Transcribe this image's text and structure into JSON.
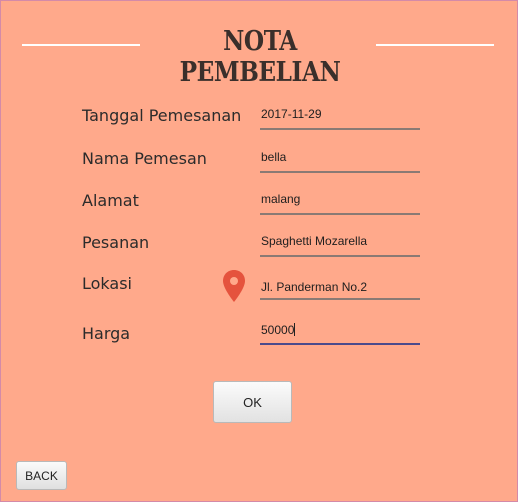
{
  "header": {
    "title": "NOTA PEMBELIAN"
  },
  "form": {
    "tanggal": {
      "label": "Tanggal Pemesanan",
      "value": "2017-11-29"
    },
    "nama": {
      "label": "Nama Pemesan",
      "value": "bella"
    },
    "alamat": {
      "label": "Alamat",
      "value": "malang"
    },
    "pesanan": {
      "label": "Pesanan",
      "value": "Spaghetti Mozarella"
    },
    "lokasi": {
      "label": "Lokasi",
      "value": "Jl. Panderman No.2",
      "icon": "location-pin-icon"
    },
    "harga": {
      "label": "Harga",
      "value": "50000"
    }
  },
  "buttons": {
    "ok_label": "OK",
    "back_label": "BACK"
  },
  "colors": {
    "background": "#ffa98b",
    "pin": "#e5533d",
    "active_underline": "#4b4b8c"
  }
}
